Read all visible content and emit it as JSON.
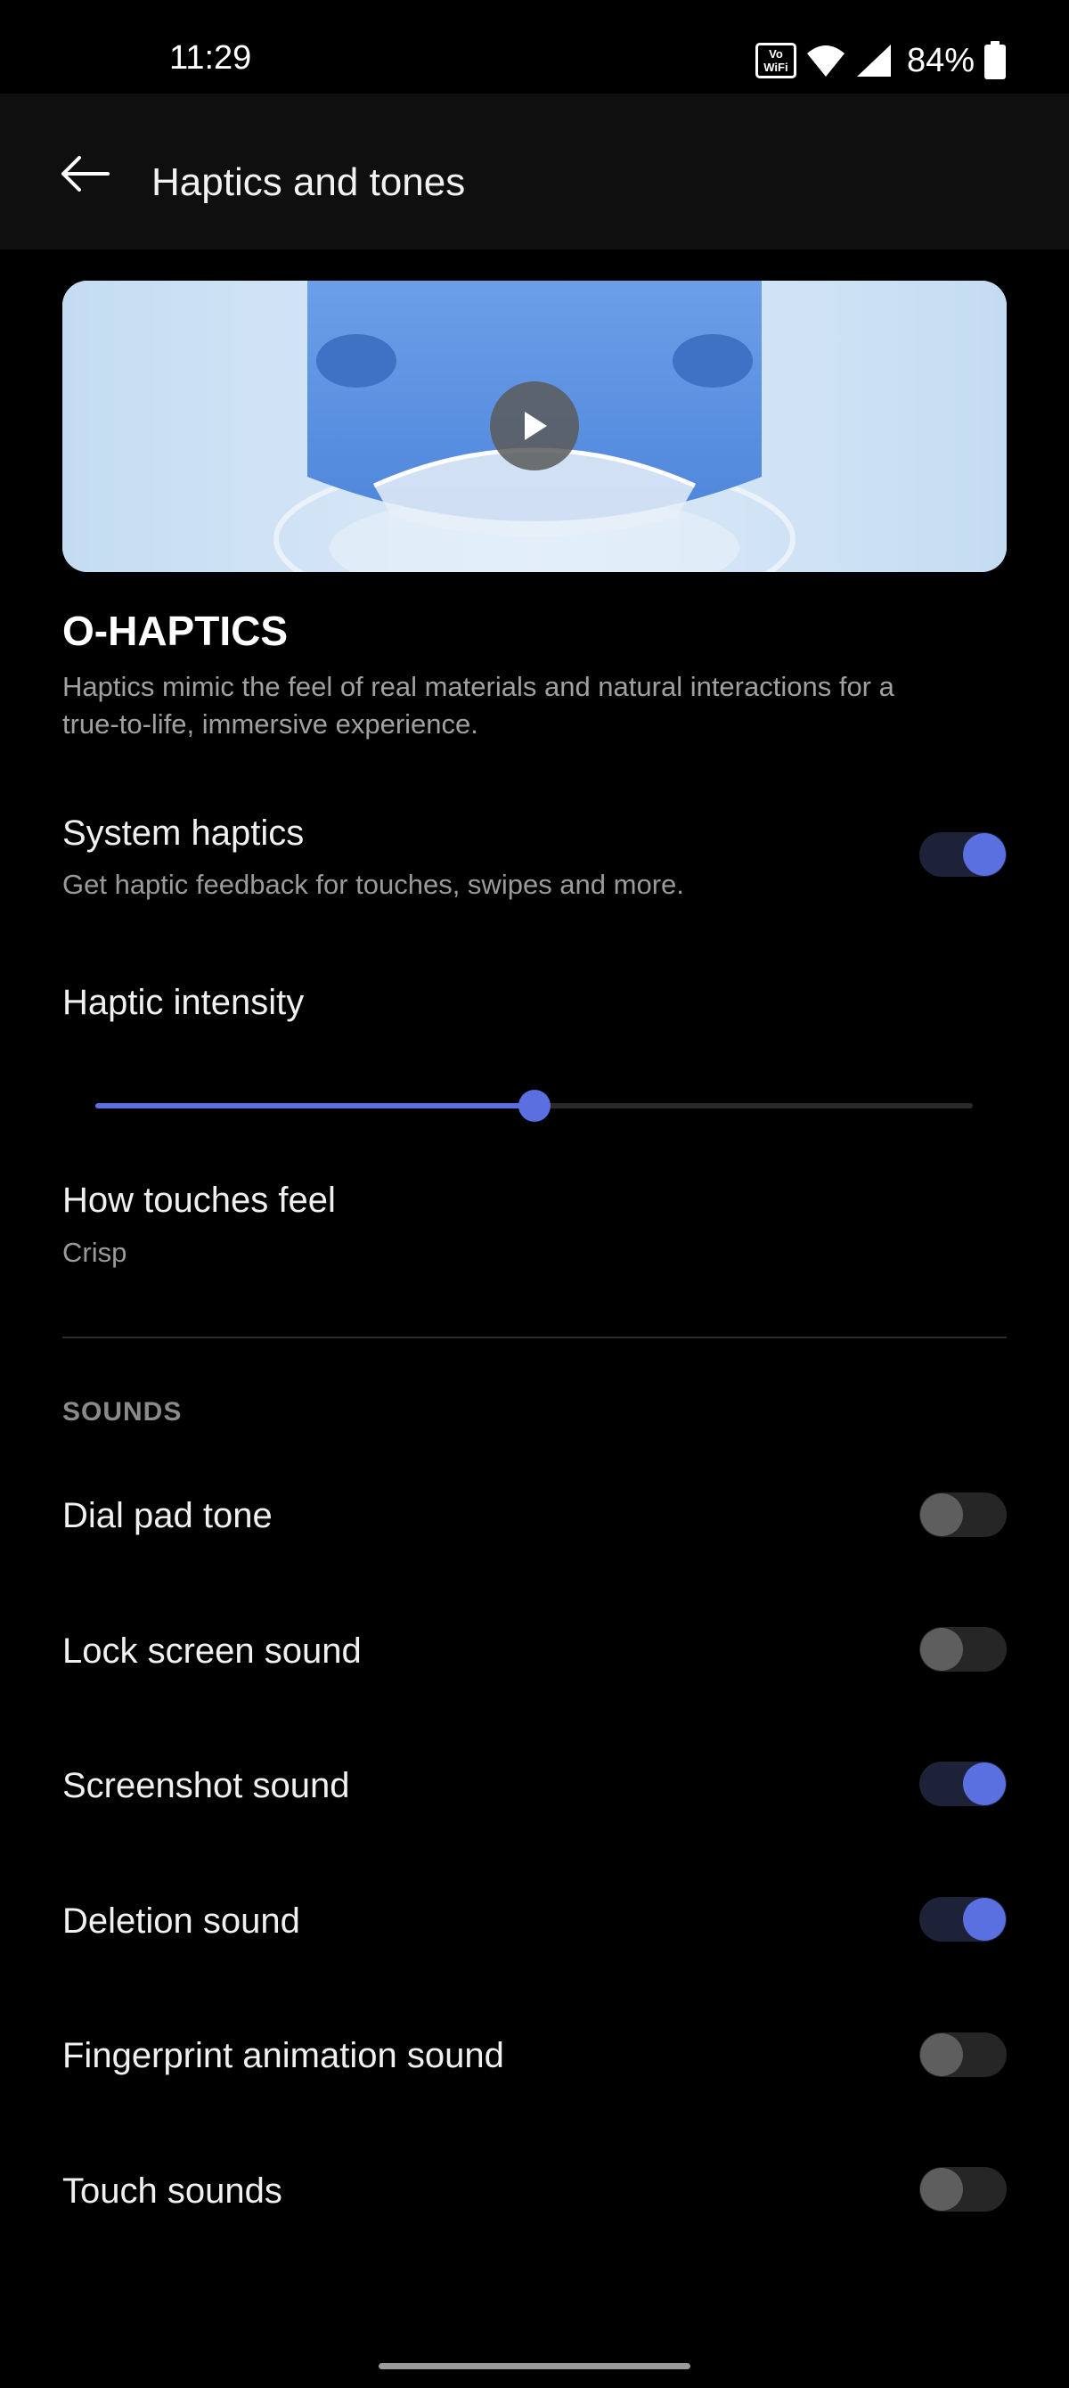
{
  "status_bar": {
    "time": "11:29",
    "vowifi_top": "Vo",
    "vowifi_bottom": "WiFi",
    "battery_percent": "84%"
  },
  "app_bar": {
    "title": "Haptics and tones"
  },
  "ohaptics": {
    "title": "O-HAPTICS",
    "description": "Haptics mimic the feel of real materials and natural interactions for a true-to-life, immersive experience."
  },
  "system_haptics": {
    "label": "System haptics",
    "subtitle": "Get haptic feedback for touches, swipes and more.",
    "enabled": true
  },
  "haptic_intensity": {
    "label": "Haptic intensity",
    "level": 0.5
  },
  "how_touches_feel": {
    "label": "How touches feel",
    "value": "Crisp"
  },
  "sounds": {
    "header": "SOUNDS",
    "items": [
      {
        "label": "Dial pad tone",
        "enabled": false
      },
      {
        "label": "Lock screen sound",
        "enabled": false
      },
      {
        "label": "Screenshot sound",
        "enabled": true
      },
      {
        "label": "Deletion sound",
        "enabled": true
      },
      {
        "label": "Fingerprint animation sound",
        "enabled": false
      },
      {
        "label": "Touch sounds",
        "enabled": false
      }
    ]
  },
  "colors": {
    "accent": "#5a6fe0",
    "background": "#000000",
    "app_bar": "#0f0f0f"
  }
}
